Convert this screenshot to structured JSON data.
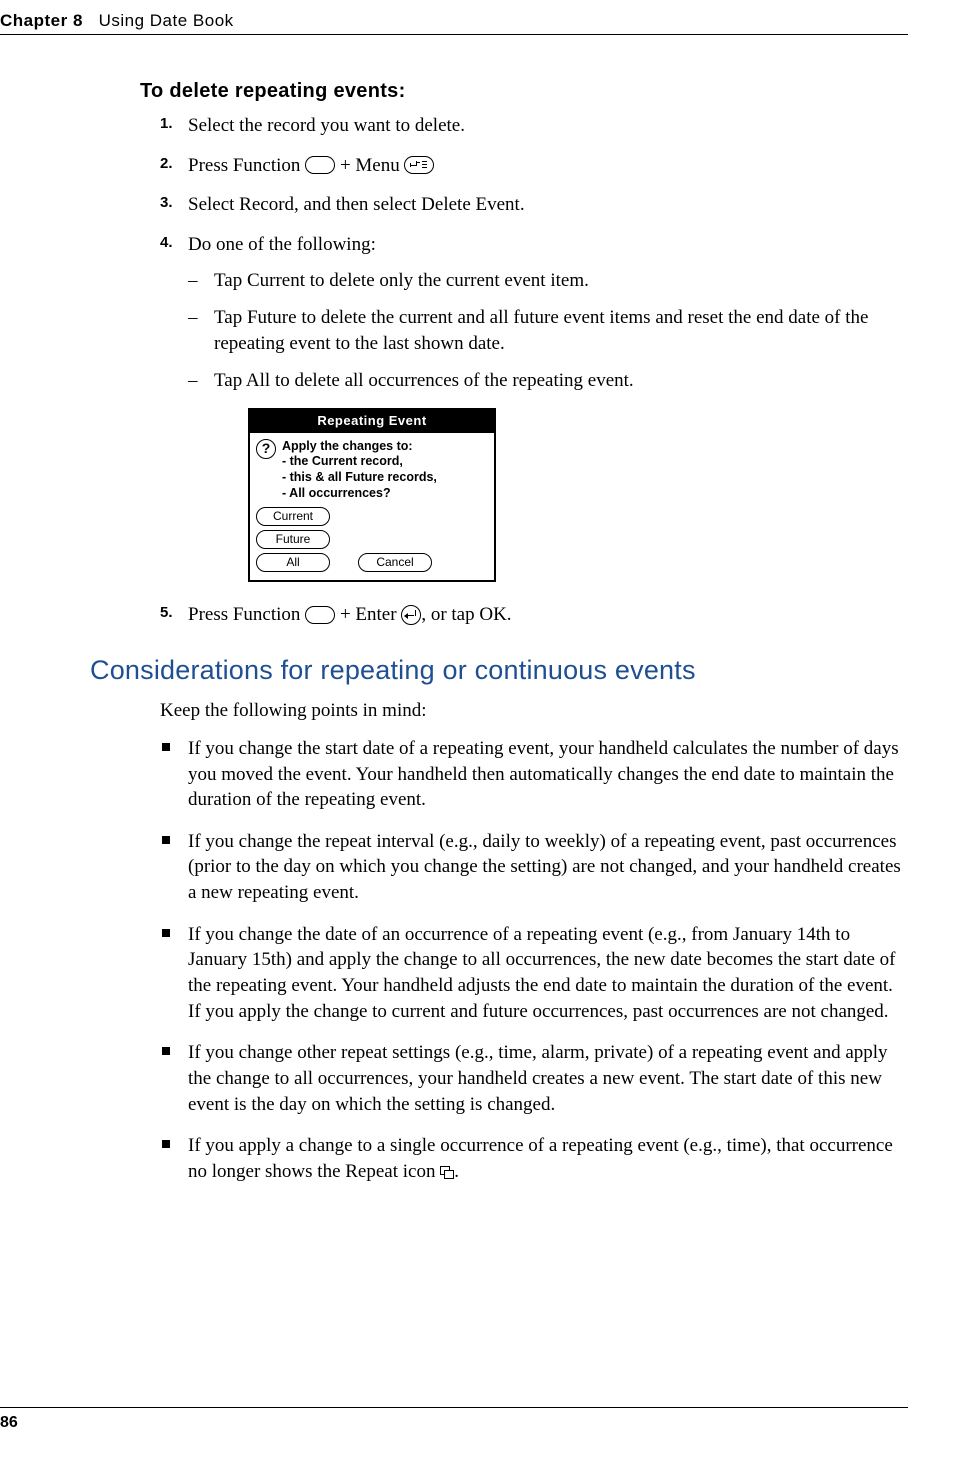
{
  "header": {
    "chapter": "Chapter 8",
    "title": "Using Date Book"
  },
  "proc_title": "To delete repeating events:",
  "steps": {
    "s1": {
      "num": "1.",
      "text": "Select the record you want to delete."
    },
    "s2": {
      "num": "2.",
      "pre": "Press Function ",
      "mid": " + Menu "
    },
    "s3": {
      "num": "3.",
      "text": "Select Record, and then select Delete Event."
    },
    "s4": {
      "num": "4.",
      "text": "Do one of the following:",
      "subs": {
        "a": "Tap Current to delete only the current event item.",
        "b": "Tap Future to delete the current and all future event items and reset the end date of the repeating event to the last shown date.",
        "c": "Tap All to delete all occurrences of the repeating event."
      }
    },
    "s5": {
      "num": "5.",
      "pre": "Press Function ",
      "mid": " + Enter ",
      "post": ", or tap OK."
    }
  },
  "dialog": {
    "title": "Repeating Event",
    "lines": {
      "l1": "Apply the changes to:",
      "l2": "- the Current record,",
      "l3": "- this & all Future records,",
      "l4": "- All occurrences?"
    },
    "buttons": {
      "current": "Current",
      "future": "Future",
      "all": "All",
      "cancel": "Cancel"
    }
  },
  "h2": "Considerations for repeating or continuous events",
  "intro": "Keep the following points in mind:",
  "bullets": {
    "b1": "If you change the start date of a repeating event, your handheld calculates the number of days you moved the event. Your handheld then automatically changes the end date to maintain the duration of the repeating event.",
    "b2": "If you change the repeat interval (e.g., daily to weekly) of a repeating event, past occurrences (prior to the day on which you change the setting) are not changed, and your handheld creates a new repeating event.",
    "b3": "If you change the date of an occurrence of a repeating event (e.g., from January 14th to January 15th) and apply the change to all occurrences, the new date becomes the start date of the repeating event. Your handheld adjusts the end date to maintain the duration of the event. If you apply the change to current and future occurrences, past occurrences are not changed.",
    "b4": "If you change other repeat settings (e.g., time, alarm, private) of a repeating event and apply the change to all occurrences, your handheld creates a new event. The start date of this new event is the day on which the setting is changed.",
    "b5_pre": "If you apply a change to a single occurrence of a repeating event (e.g., time), that occurrence no longer shows the Repeat icon ",
    "b5_post": "."
  },
  "page_number": "86"
}
